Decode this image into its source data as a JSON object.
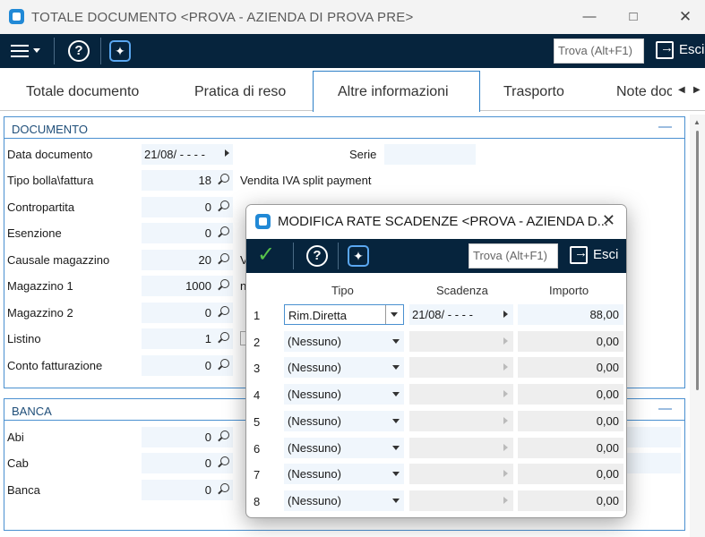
{
  "window": {
    "title": "TOTALE DOCUMENTO <PROVA - AZIENDA DI PROVA PRE>"
  },
  "toolbar": {
    "find_placeholder": "Trova (Alt+F1)",
    "exit_label": "Esci"
  },
  "tabs": [
    {
      "label": "Totale documento"
    },
    {
      "label": "Pratica di reso"
    },
    {
      "label": "Altre informazioni"
    },
    {
      "label": "Trasporto"
    },
    {
      "label": "Note doc"
    }
  ],
  "documento": {
    "header": "DOCUMENTO",
    "data_label": "Data documento",
    "data_value": "21/08/ - - - -",
    "serie_label": "Serie",
    "tipo_label": "Tipo bolla\\fattura",
    "tipo_value": "18",
    "tipo_desc": "Vendita IVA split payment",
    "contropartita_label": "Contropartita",
    "contropartita_value": "0",
    "esenzione_label": "Esenzione",
    "esenzione_value": "0",
    "causale_label": "Causale magazzino",
    "causale_value": "20",
    "causale_desc": "V",
    "magazzino1_label": "Magazzino 1",
    "magazzino1_value": "1000",
    "magazzino1_desc": "n",
    "magazzino2_label": "Magazzino 2",
    "magazzino2_value": "0",
    "listino_label": "Listino",
    "listino_value": "1",
    "conto_label": "Conto fatturazione",
    "conto_value": "0"
  },
  "banca": {
    "header": "BANCA",
    "abi_label": "Abi",
    "abi_value": "0",
    "cab_label": "Cab",
    "cab_value": "0",
    "banca_label": "Banca",
    "banca_value": "0"
  },
  "dialog": {
    "title": "MODIFICA RATE SCADENZE <PROVA - AZIENDA D...",
    "find_placeholder": "Trova (Alt+F1)",
    "exit_label": "Esci",
    "col_tipo": "Tipo",
    "col_scadenza": "Scadenza",
    "col_importo": "Importo",
    "rows": [
      {
        "n": "1",
        "tipo": "Rim.Diretta",
        "scadenza": "21/08/ - - - -",
        "importo": "88,00"
      },
      {
        "n": "2",
        "tipo": "(Nessuno)",
        "scadenza": "",
        "importo": "0,00"
      },
      {
        "n": "3",
        "tipo": "(Nessuno)",
        "scadenza": "",
        "importo": "0,00"
      },
      {
        "n": "4",
        "tipo": "(Nessuno)",
        "scadenza": "",
        "importo": "0,00"
      },
      {
        "n": "5",
        "tipo": "(Nessuno)",
        "scadenza": "",
        "importo": "0,00"
      },
      {
        "n": "6",
        "tipo": "(Nessuno)",
        "scadenza": "",
        "importo": "0,00"
      },
      {
        "n": "7",
        "tipo": "(Nessuno)",
        "scadenza": "",
        "importo": "0,00"
      },
      {
        "n": "8",
        "tipo": "(Nessuno)",
        "scadenza": "",
        "importo": "0,00"
      }
    ]
  }
}
